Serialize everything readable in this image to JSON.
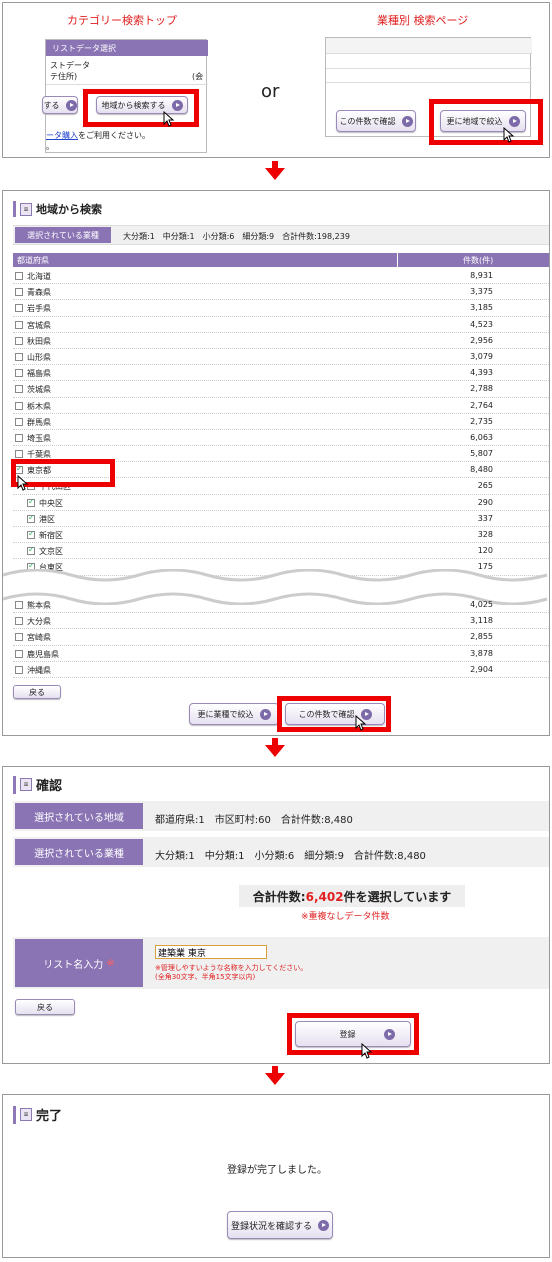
{
  "top": {
    "left_caption": "カテゴリー検索トップ",
    "right_caption": "業種別 検索ページ",
    "or_text": "or",
    "left_header": "リストデータ選択",
    "left_line1": "ストデータ",
    "left_line2": "テ住所)",
    "left_line2_right": "(会",
    "left_btn_partial": "する",
    "left_btn": "地域から検索する",
    "left_link": "ータ購入",
    "left_link_after": "をご利用ください。",
    "left_dot": "。",
    "right_btn1": "この件数で確認",
    "right_btn2": "更に地域で絞込"
  },
  "region": {
    "title": "地域から検索",
    "title_icon": "doc-icon",
    "selected_label": "選択されている業種",
    "summary": "大分類:1　中分類:1　小分類:6　細分類:9　合計件数:198,239",
    "col_pref": "都道府県",
    "col_count": "件数(件)",
    "rows_top": [
      {
        "name": "北海道",
        "count": "8,931",
        "checked": false,
        "sub": false
      },
      {
        "name": "青森県",
        "count": "3,375",
        "checked": false,
        "sub": false
      },
      {
        "name": "岩手県",
        "count": "3,185",
        "checked": false,
        "sub": false
      },
      {
        "name": "宮城県",
        "count": "4,523",
        "checked": false,
        "sub": false
      },
      {
        "name": "秋田県",
        "count": "2,956",
        "checked": false,
        "sub": false
      },
      {
        "name": "山形県",
        "count": "3,079",
        "checked": false,
        "sub": false
      },
      {
        "name": "福島県",
        "count": "4,393",
        "checked": false,
        "sub": false
      },
      {
        "name": "茨城県",
        "count": "2,788",
        "checked": false,
        "sub": false
      },
      {
        "name": "栃木県",
        "count": "2,764",
        "checked": false,
        "sub": false
      },
      {
        "name": "群馬県",
        "count": "2,735",
        "checked": false,
        "sub": false
      },
      {
        "name": "埼玉県",
        "count": "6,063",
        "checked": false,
        "sub": false
      },
      {
        "name": "千葉県",
        "count": "5,807",
        "checked": false,
        "sub": false
      },
      {
        "name": "東京都",
        "count": "8,480",
        "checked": true,
        "sub": false
      },
      {
        "name": "千代田区",
        "count": "265",
        "checked": true,
        "sub": true
      },
      {
        "name": "中央区",
        "count": "290",
        "checked": true,
        "sub": true
      },
      {
        "name": "港区",
        "count": "337",
        "checked": true,
        "sub": true
      },
      {
        "name": "新宿区",
        "count": "328",
        "checked": true,
        "sub": true
      },
      {
        "name": "文京区",
        "count": "120",
        "checked": true,
        "sub": true
      },
      {
        "name": "台東区",
        "count": "175",
        "checked": true,
        "sub": true
      }
    ],
    "rows_bottom": [
      {
        "name": "熊本県",
        "count": "4,025",
        "checked": false,
        "sub": false
      },
      {
        "name": "大分県",
        "count": "3,118",
        "checked": false,
        "sub": false
      },
      {
        "name": "宮崎県",
        "count": "2,855",
        "checked": false,
        "sub": false
      },
      {
        "name": "鹿児島県",
        "count": "3,878",
        "checked": false,
        "sub": false
      },
      {
        "name": "沖縄県",
        "count": "2,904",
        "checked": false,
        "sub": false
      }
    ],
    "back_btn": "戻る",
    "btn_more": "更に業種で絞込",
    "btn_confirm": "この件数で確認"
  },
  "confirm": {
    "title": "確認",
    "region_label": "選択されている地域",
    "region_value": "都道府県:1　市区町村:60　合計件数:8,480",
    "industry_label": "選択されている業種",
    "industry_value": "大分類:1　中分類:1　小分類:6　細分類:9　合計件数:8,480",
    "total_prefix": "合計件数:",
    "total_value": "6,402",
    "total_suffix": "件を選択しています",
    "total_note": "※重複なしデータ件数",
    "list_label": "リスト名入力",
    "list_mark": "※",
    "list_value": "建築業 東京",
    "list_note1": "※管理しやすいような名称を入力してください。",
    "list_note2": "(全角30文字、半角15文字以内)",
    "back_btn": "戻る",
    "register_btn": "登録"
  },
  "done": {
    "title": "完了",
    "message": "登録が完了しました。",
    "status_btn": "登録状況を確認する"
  },
  "colors": {
    "accent": "#8a74b4",
    "highlight": "#ee0000"
  }
}
